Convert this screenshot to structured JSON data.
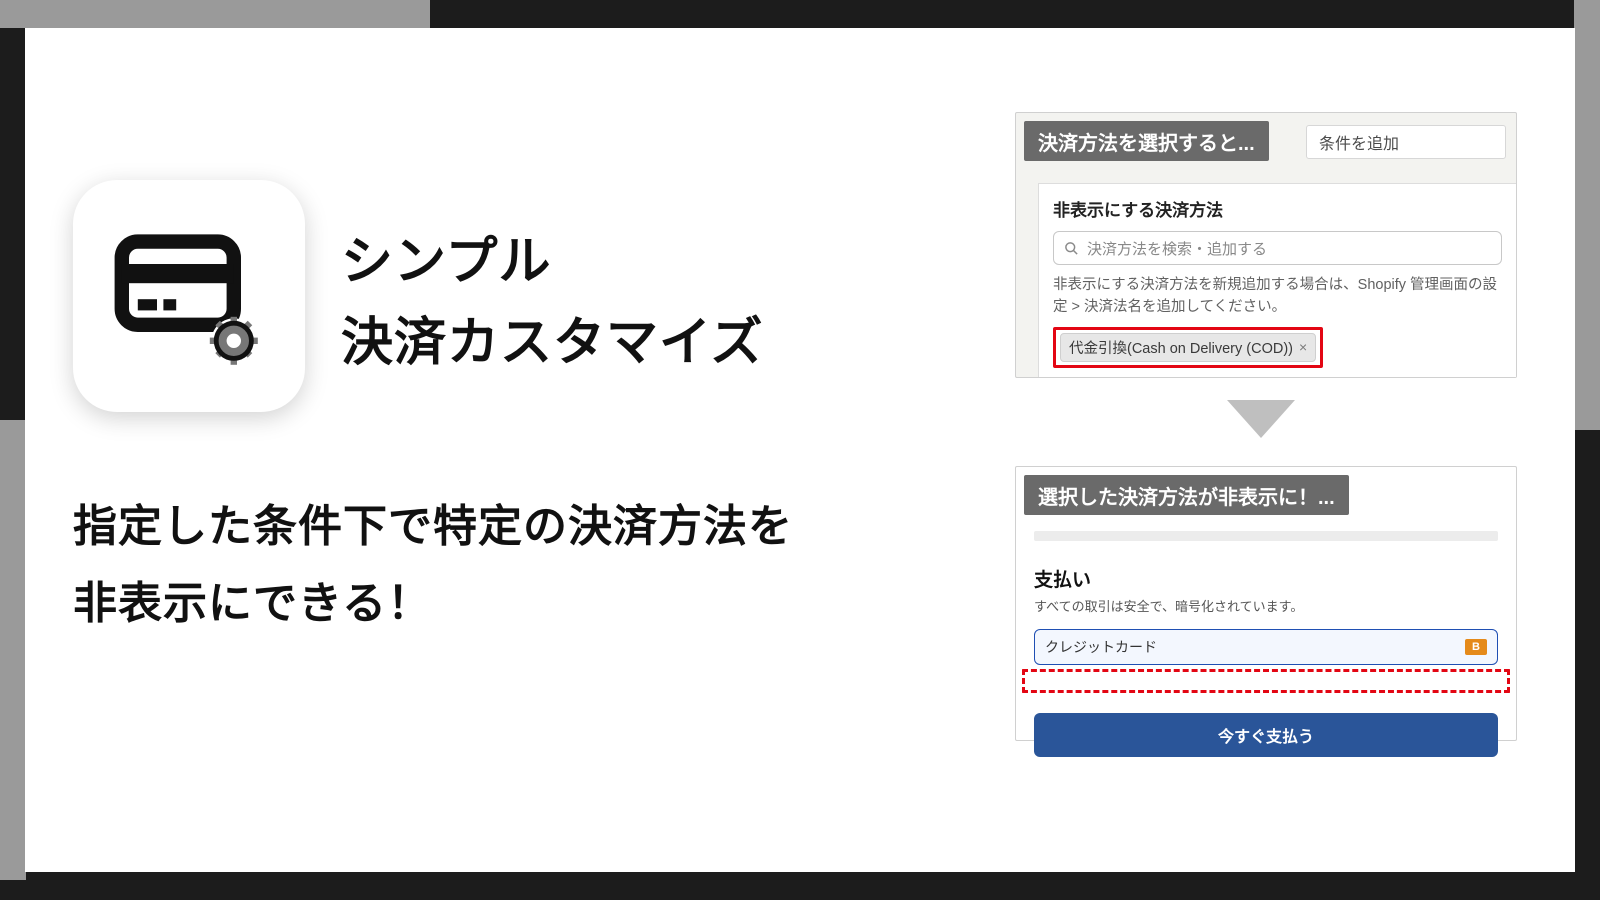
{
  "app": {
    "title_line1": "シンプル",
    "title_line2": "決済カスタマイズ",
    "subhead_line1": "指定した条件下で特定の決済方法を",
    "subhead_line2": "非表示にできる！"
  },
  "panel_a": {
    "tab_active_label": "決済方法を選択すると...",
    "tab_add_condition_label": "条件を追加",
    "section_title": "非表示にする決済方法",
    "search_placeholder": "決済方法を検索・追加する",
    "hint_text": "非表示にする決済方法を新規追加する場合は、Shopify 管理画面の設定 > 決済法名を追加してください。",
    "selected_tag": "代金引換(Cash on Delivery (COD))"
  },
  "panel_b": {
    "tab_active_label": "選択した決済方法が非表示に！...",
    "pay_title": "支払い",
    "pay_sub": "すべての取引は安全で、暗号化されています。",
    "method_label": "クレジットカード",
    "badge_letter": "B",
    "button_label": "今すぐ支払う"
  }
}
